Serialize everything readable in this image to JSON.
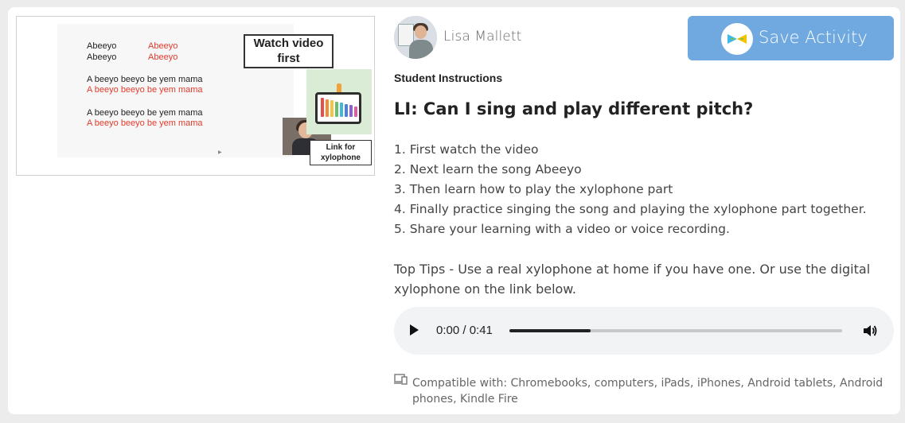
{
  "thumbnail": {
    "lyrics_black_1": "Abeeyo",
    "lyrics_black_2": "Abeeyo",
    "lyrics_red_1": "Abeeyo",
    "lyrics_red_2": "Abeeyo",
    "line_black_1": "A beeyo beeyo be yem mama",
    "line_red_1": "A beeyo beeyo be yem mama",
    "line_black_2": "A beeyo beeyo be yem mama",
    "line_red_2": "A beeyo beeyo be yem mama",
    "watch_line1": "Watch video",
    "watch_line2": "first",
    "link_line1": "Link for",
    "link_line2": "xylophone",
    "xylophone_icon": "xylophone-icon",
    "xylophone_bar_colors": [
      "#e84d4d",
      "#f28a3a",
      "#f4c542",
      "#6cc06b",
      "#43b9d6",
      "#4c7fe0",
      "#8a63d2",
      "#e05aa6"
    ]
  },
  "author": {
    "name": "Lisa Mallett",
    "avatar_icon": "user-avatar"
  },
  "save_button": {
    "label": "Save Activity",
    "icon": "seesaw-logo-icon",
    "color": "#6fa9e0"
  },
  "instructions": {
    "heading": "Student Instructions",
    "title": "LI: Can I sing and play different pitch?",
    "steps": [
      "1. First watch the video",
      "2. Next learn the song Abeeyo",
      "3. Then learn how to play the xylophone part",
      "4. Finally practice singing the song and playing the xylophone part together.",
      "5. Share your learning with a video or voice recording."
    ],
    "tips": "Top Tips - Use a real xylophone at home if you have one. Or use the digital xylophone on the link below."
  },
  "audio_player": {
    "time": "0:00 / 0:41",
    "progress_fraction": 0.245,
    "play_icon": "play-icon",
    "volume_icon": "volume-icon"
  },
  "compatibility": {
    "text": "Compatible with: Chromebooks, computers, iPads, iPhones, Android tablets, Android phones, Kindle Fire",
    "icon": "devices-icon"
  }
}
